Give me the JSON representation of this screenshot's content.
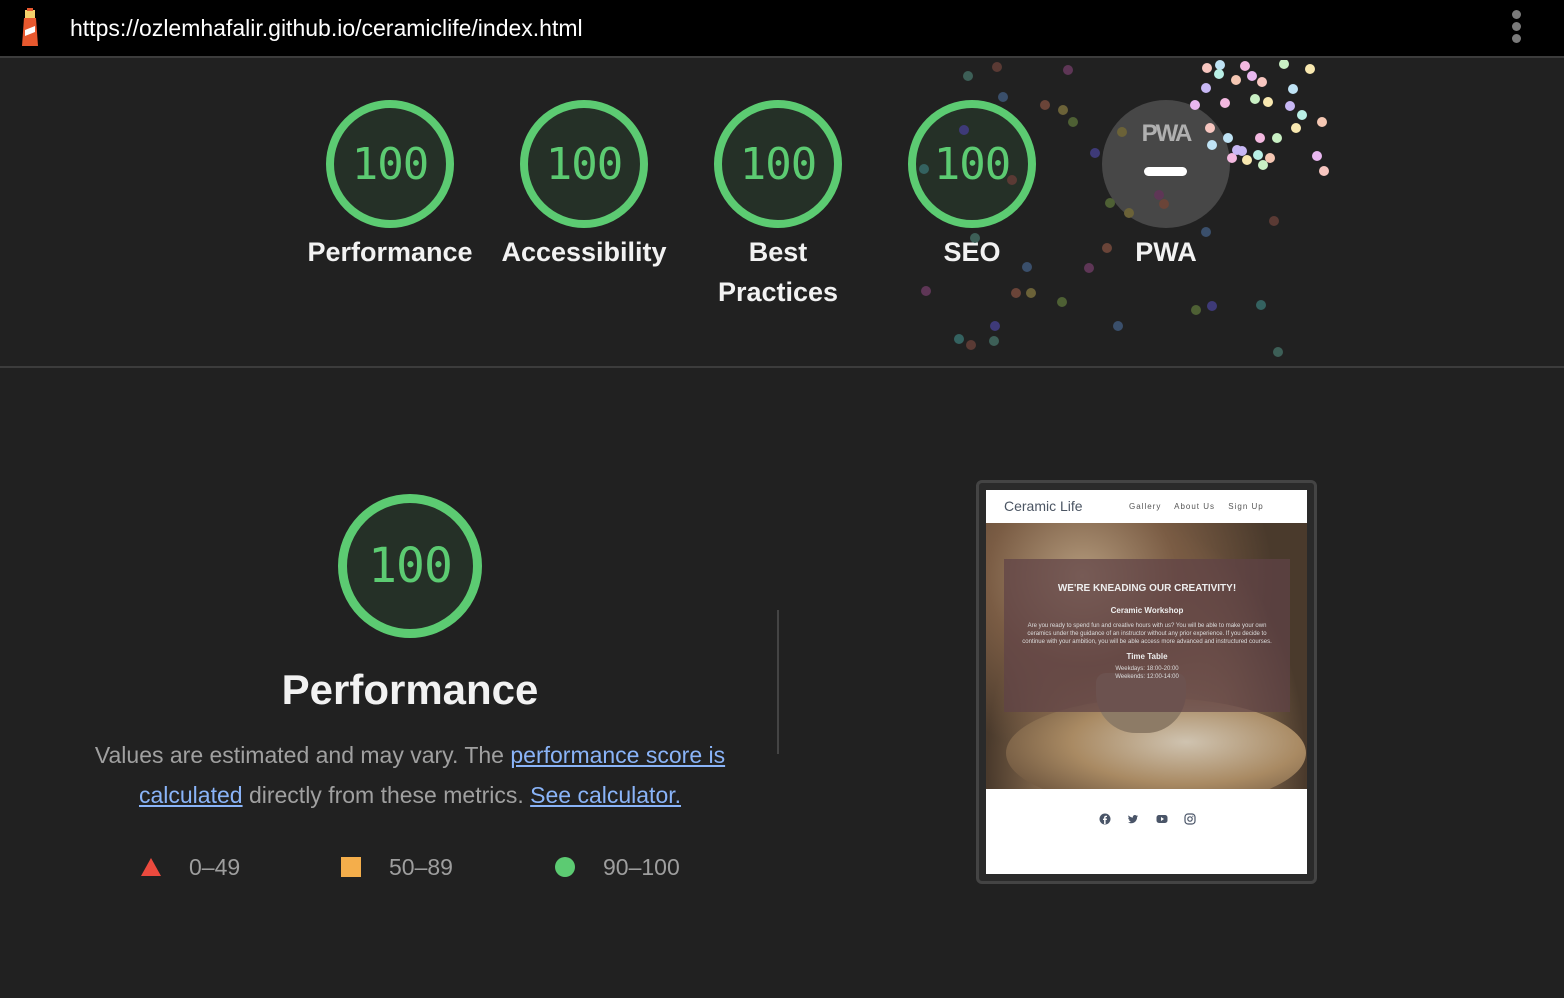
{
  "topbar": {
    "url": "https://ozlemhafalir.github.io/ceramiclife/index.html",
    "logo_icon": "lighthouse-icon",
    "menu_icon": "more-vertical-icon"
  },
  "summary": {
    "gauges": [
      {
        "label": "Performance",
        "score": "100"
      },
      {
        "label": "Accessibility",
        "score": "100"
      },
      {
        "label": "Best Practices",
        "score": "100"
      },
      {
        "label": "SEO",
        "score": "100"
      },
      {
        "label": "PWA",
        "badge_text": "PWA",
        "score": "—"
      }
    ]
  },
  "performance": {
    "score": "100",
    "title": "Performance",
    "desc_prefix": "Values are estimated and may vary. The ",
    "link_score": "performance score is calculated",
    "desc_middle": " directly from these metrics. ",
    "link_calculator": "See calculator.",
    "legend": [
      {
        "shape": "triangle",
        "range": "0–49",
        "color": "#eb4a3e"
      },
      {
        "shape": "square",
        "range": "50–89",
        "color": "#f4ae4b"
      },
      {
        "shape": "circle",
        "range": "90–100",
        "color": "#5ccb72"
      }
    ]
  },
  "screenshot": {
    "brand": "Ceramic Life",
    "nav": [
      "Gallery",
      "About Us",
      "Sign Up"
    ],
    "hero_title": "WE'RE KNEADING OUR CREATIVITY!",
    "workshop_title": "Ceramic Workshop",
    "workshop_text": "Are you ready to spend fun and creative hours with us? You will be able to make your own ceramics under the guidance of an instructor without any prior experience. If you decide to continue with your ambition, you will be able access more advanced and instructured courses.",
    "timetable_title": "Time Table",
    "weekdays": "Weekdays: 18:00-20:00",
    "weekends": "Weekends: 12:00-14:00",
    "social_icons": [
      "facebook-icon",
      "twitter-icon",
      "youtube-icon",
      "instagram-icon"
    ]
  },
  "colors": {
    "pass": "#5ccb72",
    "average": "#f4ae4b",
    "fail": "#eb4a3e",
    "link": "#8ab4f8",
    "background": "#212121"
  }
}
